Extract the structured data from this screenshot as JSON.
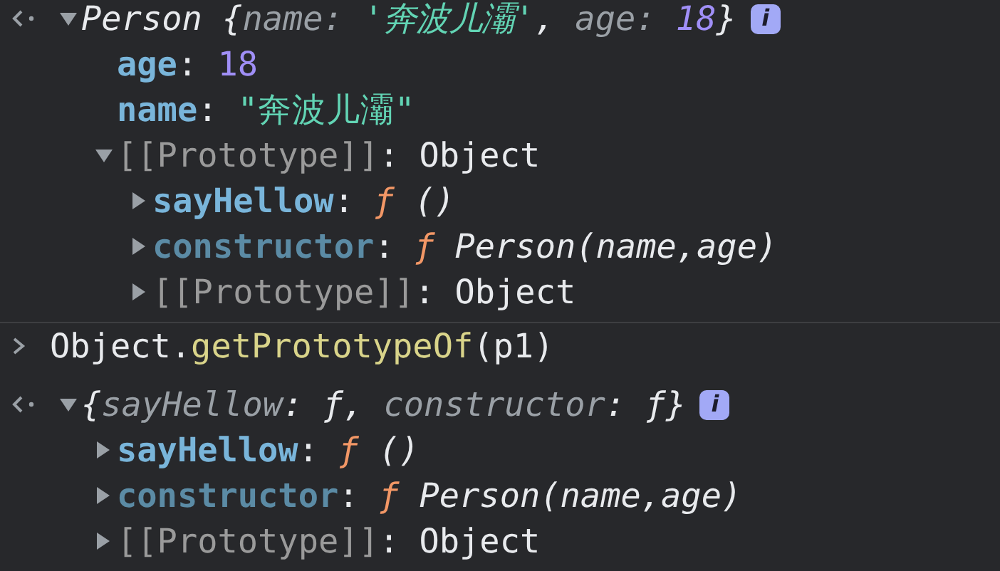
{
  "console": {
    "entries": [
      {
        "kind": "result",
        "expanded": true,
        "segments": [
          {
            "kind": "italic",
            "text": "Person {"
          },
          {
            "kind": "preview-key",
            "text": "name: "
          },
          {
            "kind": "preview-string",
            "text": "'奔波儿灞'"
          },
          {
            "kind": "italic",
            "text": ", "
          },
          {
            "kind": "preview-key",
            "text": "age: "
          },
          {
            "kind": "preview-number",
            "text": "18"
          },
          {
            "kind": "italic",
            "text": "}"
          }
        ],
        "info": "i",
        "children": [
          {
            "kind": "leaf",
            "segments": [
              {
                "kind": "key",
                "text": "age"
              },
              {
                "kind": "plain",
                "text": ": "
              },
              {
                "kind": "number",
                "text": "18"
              }
            ]
          },
          {
            "kind": "leaf",
            "segments": [
              {
                "kind": "key",
                "text": "name"
              },
              {
                "kind": "plain",
                "text": ": "
              },
              {
                "kind": "string",
                "text": "\"奔波儿灞\""
              }
            ]
          },
          {
            "kind": "node",
            "expanded": true,
            "segments": [
              {
                "kind": "internal",
                "text": "[[Prototype]]"
              },
              {
                "kind": "plain",
                "text": ": Object"
              }
            ],
            "children": [
              {
                "kind": "node",
                "expanded": false,
                "segments": [
                  {
                    "kind": "key",
                    "text": "sayHellow"
                  },
                  {
                    "kind": "plain",
                    "text": ": "
                  },
                  {
                    "kind": "fn",
                    "text": "ƒ"
                  },
                  {
                    "kind": "signature",
                    "text": " ()"
                  }
                ]
              },
              {
                "kind": "node",
                "expanded": false,
                "segments": [
                  {
                    "kind": "key-hidden",
                    "text": "constructor"
                  },
                  {
                    "kind": "plain",
                    "text": ": "
                  },
                  {
                    "kind": "fn",
                    "text": "ƒ"
                  },
                  {
                    "kind": "signature",
                    "text": " Person(name,age)"
                  }
                ]
              },
              {
                "kind": "node",
                "expanded": false,
                "segments": [
                  {
                    "kind": "internal",
                    "text": "[[Prototype]]"
                  },
                  {
                    "kind": "plain",
                    "text": ": Object"
                  }
                ]
              }
            ]
          }
        ]
      },
      {
        "kind": "input",
        "segments": [
          {
            "kind": "plain",
            "text": "Object."
          },
          {
            "kind": "method",
            "text": "getPrototypeOf"
          },
          {
            "kind": "plain",
            "text": "(p1)"
          }
        ]
      },
      {
        "kind": "result",
        "expanded": true,
        "segments": [
          {
            "kind": "italic",
            "text": "{"
          },
          {
            "kind": "preview-key",
            "text": "sayHellow"
          },
          {
            "kind": "italic",
            "text": ": ƒ, "
          },
          {
            "kind": "preview-key",
            "text": "constructor"
          },
          {
            "kind": "italic",
            "text": ": ƒ}"
          }
        ],
        "info": "i",
        "children": [
          {
            "kind": "node",
            "expanded": false,
            "segments": [
              {
                "kind": "key",
                "text": "sayHellow"
              },
              {
                "kind": "plain",
                "text": ": "
              },
              {
                "kind": "fn",
                "text": "ƒ"
              },
              {
                "kind": "signature",
                "text": " ()"
              }
            ]
          },
          {
            "kind": "node",
            "expanded": false,
            "segments": [
              {
                "kind": "key-hidden",
                "text": "constructor"
              },
              {
                "kind": "plain",
                "text": ": "
              },
              {
                "kind": "fn",
                "text": "ƒ"
              },
              {
                "kind": "signature",
                "text": " Person(name,age)"
              }
            ]
          },
          {
            "kind": "node",
            "expanded": false,
            "segments": [
              {
                "kind": "internal",
                "text": "[[Prototype]]"
              },
              {
                "kind": "plain",
                "text": ": Object"
              }
            ]
          }
        ]
      }
    ]
  }
}
